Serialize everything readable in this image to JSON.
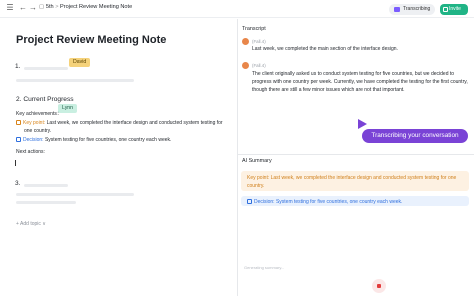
{
  "breadcrumb": {
    "parent": "5th",
    "separator": ">",
    "title": "Project Review Meeting Note"
  },
  "header": {
    "transcribing_label": "Transcribing",
    "invite_label": "Invite"
  },
  "document": {
    "title": "Project Review Meeting Note",
    "section1_num": "1.",
    "tag1": "David",
    "section2_title": "2. Current Progress",
    "tag2": "Lynn",
    "key_achievements_label": "Key achievements：",
    "kp_prefix": "Key point:",
    "kp_text_1": " Last week, we completed the interface design and conducted system testing for",
    "kp_text_2": "one country.",
    "dec_prefix": "Decision:",
    "dec_text": " System testing for five countries, one country each week.",
    "next_actions_label": "Next actions:",
    "section3_num": "3.",
    "add_topic": "+  Add topic  ∨"
  },
  "transcript": {
    "heading": "Transcript",
    "speaker1": "(Fall.4)",
    "line1": "Last week, we completed the main section of the interface design.",
    "speaker2": "(Fall.4)",
    "line2a": "The client originally asked us to conduct system testing for five countries, but we decided to",
    "line2b": "progress with one country per week. Currently, we have completed the testing for the first country,",
    "line2c": "though there are still a few minor issues which are not that important.",
    "cta": "Transcribing your conversation"
  },
  "summary": {
    "heading": "AI Summary",
    "kp_text_1": "Key point: Last week, we completed the interface design and conducted system testing for one",
    "kp_text_2": "country.",
    "dec_text": "Decision: System testing for five countries, one country each week."
  },
  "footer": {
    "hint": "Generating summary..."
  },
  "colors": {
    "accent_purple": "#7a43d6",
    "invite_green": "#20b486",
    "key_point_orange": "#d8841a",
    "decision_blue": "#2f6fde"
  }
}
